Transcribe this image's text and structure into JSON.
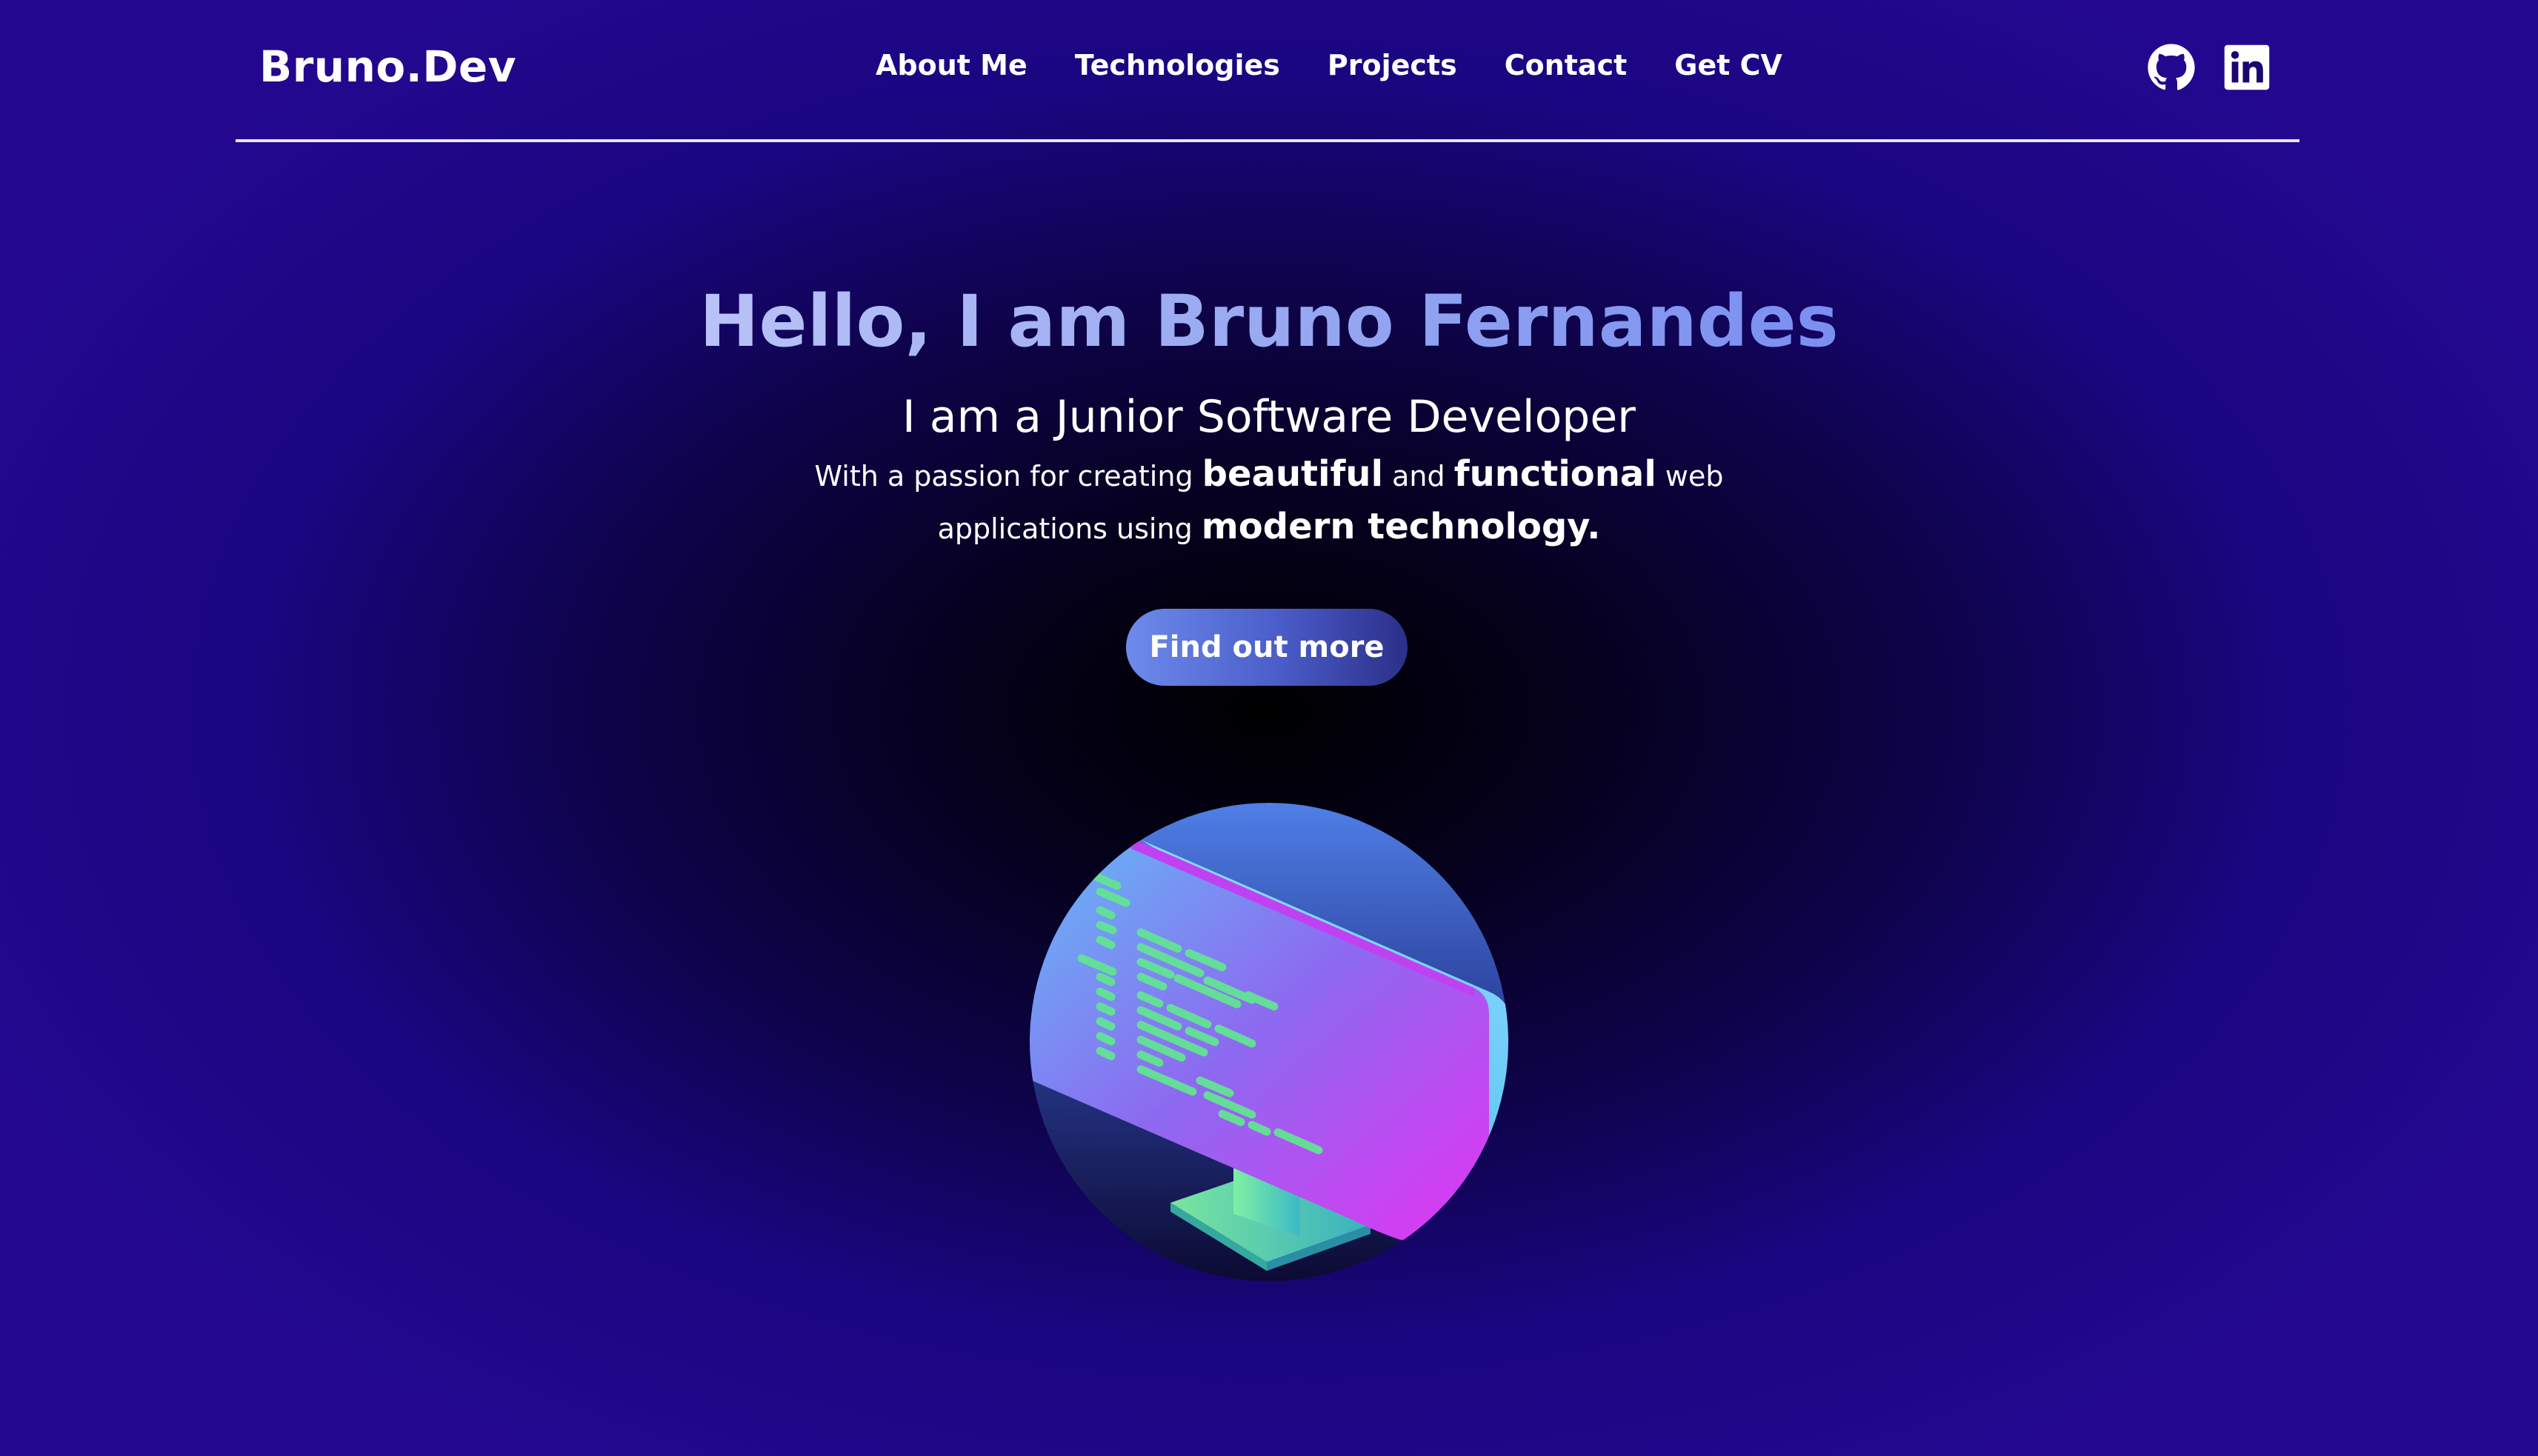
{
  "header": {
    "logo": "Bruno.Dev",
    "nav": [
      "About Me",
      "Technologies",
      "Projects",
      "Contact",
      "Get CV"
    ]
  },
  "social": {
    "items": [
      {
        "icon": "github-icon"
      },
      {
        "icon": "linkedin-icon"
      }
    ]
  },
  "hero": {
    "title": "Hello, I am Bruno Fernandes",
    "subtitle": "I am a Junior Software Developer",
    "desc": {
      "t1": "With a passion for creating ",
      "b1": "beautiful",
      "t2": " and ",
      "b2": "functional",
      "t3": " web",
      "t4": "applications using ",
      "b3": "modern technology."
    },
    "cta_label": "Find out more"
  },
  "colors": {
    "title_gradient_start": "#b9c2f8",
    "title_gradient_end": "#7a8ef0",
    "background_center": "#000000",
    "background_edge": "#23088f",
    "button_gradient_start": "#6d8bec",
    "button_gradient_end": "#2b2f88"
  }
}
